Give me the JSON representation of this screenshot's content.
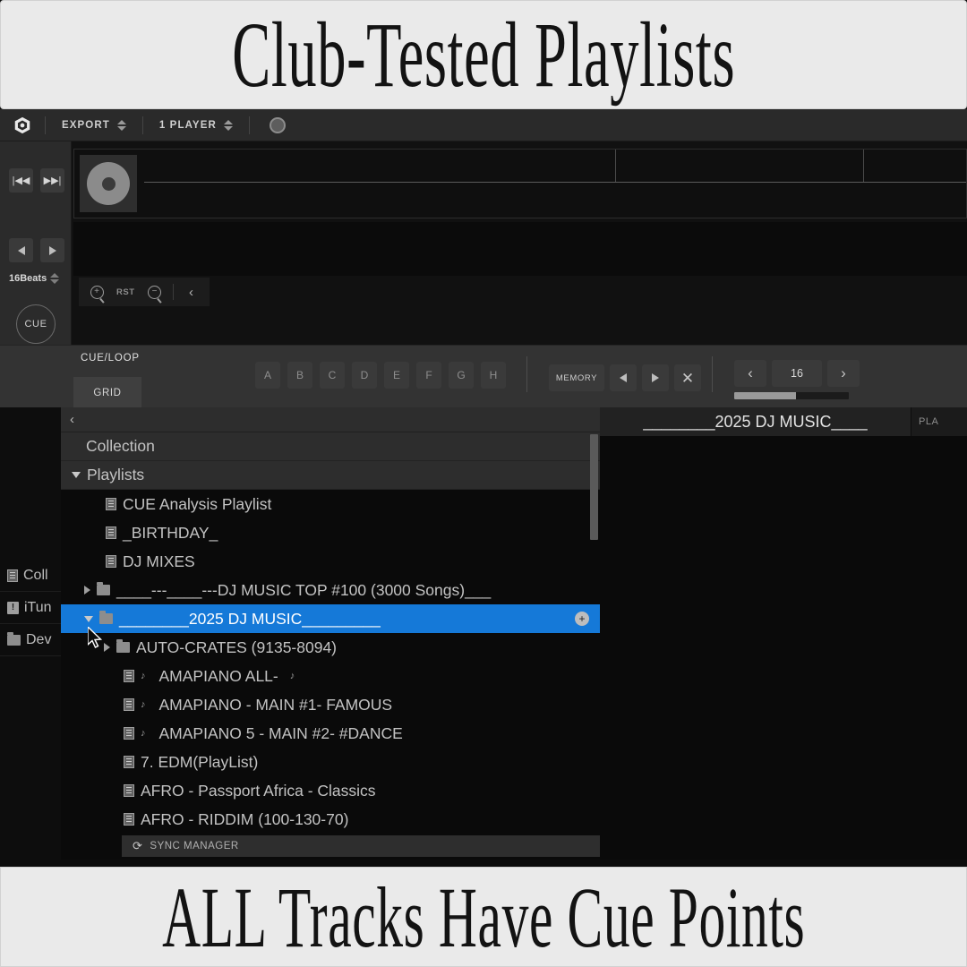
{
  "banners": {
    "top": "Club-Tested Playlists",
    "bottom": "ALL Tracks Have Cue Points"
  },
  "toolbar": {
    "logo_icon": "rekordbox-logo-icon",
    "export_label": "EXPORT",
    "player_label": "1 PLAYER",
    "record_icon": "record-icon"
  },
  "deck": {
    "prev_track_label": "|◀◀",
    "next_track_label": "▶▶|",
    "beats_label": "16Beats",
    "cue_label": "CUE",
    "play_icon": "play-icon",
    "zoom_in_icon": "zoom-in-icon",
    "zoom_reset_label": "RST",
    "zoom_out_icon": "zoom-out-icon",
    "collapse_icon": "chevron-left-icon",
    "disc_icon": "disc-icon"
  },
  "cueloop": {
    "title": "CUE/LOOP",
    "grid_tab": "GRID",
    "hotcues": [
      "A",
      "B",
      "C",
      "D",
      "E",
      "F",
      "G",
      "H"
    ],
    "memory_label": "MEMORY",
    "memory_prev_icon": "triangle-left-icon",
    "memory_next_icon": "triangle-right-icon",
    "memory_delete_icon": "close-x-icon",
    "beatjump_prev_icon": "chevron-left-icon",
    "beatjump_value": "16",
    "beatjump_next_icon": "chevron-right-icon",
    "beatjump_fill_pct": 54
  },
  "left_strip": {
    "items": [
      {
        "icon": "collection-list-icon",
        "label": "Coll"
      },
      {
        "icon": "itunes-warning-icon",
        "label": "iTun"
      },
      {
        "icon": "folder-icon",
        "label": "Dev"
      }
    ]
  },
  "tree": {
    "collapse_icon": "chevron-left-icon",
    "rows": [
      {
        "label": "Collection",
        "icon": "none",
        "caret": "none",
        "indent": 1,
        "style": "shaded",
        "selected": false
      },
      {
        "label": "Playlists",
        "icon": "none",
        "caret": "down",
        "indent": 0,
        "style": "shaded",
        "selected": false
      },
      {
        "label": "CUE Analysis Playlist",
        "icon": "list",
        "caret": "none",
        "indent": 2,
        "style": "plain",
        "selected": false
      },
      {
        "label": "_BIRTHDAY_",
        "icon": "list",
        "caret": "none",
        "indent": 2,
        "style": "plain",
        "selected": false
      },
      {
        "label": "DJ MIXES",
        "icon": "list",
        "caret": "none",
        "indent": 2,
        "style": "plain",
        "selected": false
      },
      {
        "label": "____---____---DJ MUSIC TOP #100 (3000 Songs)___",
        "icon": "folder",
        "caret": "right",
        "indent": 1,
        "style": "plain",
        "selected": false
      },
      {
        "label": "________2025 DJ MUSIC_________",
        "icon": "folder",
        "caret": "down",
        "indent": 1,
        "style": "plain",
        "selected": true,
        "badge": "+"
      },
      {
        "label": "AUTO-CRATES (9135-8094)",
        "icon": "folder",
        "caret": "right",
        "indent": 2,
        "style": "plain",
        "selected": false
      },
      {
        "label": "AMAPIANO ALL-",
        "icon": "list-note",
        "caret": "none",
        "indent": 3,
        "style": "plain",
        "selected": false
      },
      {
        "label": "AMAPIANO - MAIN #1- FAMOUS",
        "icon": "list-note",
        "caret": "none",
        "indent": 3,
        "style": "plain",
        "selected": false
      },
      {
        "label": "AMAPIANO 5 -  MAIN #2- #DANCE",
        "icon": "list-note",
        "caret": "none",
        "indent": 3,
        "style": "plain",
        "selected": false
      },
      {
        "label": "7. EDM(PlayList)",
        "icon": "list",
        "caret": "none",
        "indent": 3,
        "style": "plain",
        "selected": false
      },
      {
        "label": "AFRO - Passport Africa - Classics",
        "icon": "list",
        "caret": "none",
        "indent": 3,
        "style": "plain",
        "selected": false
      },
      {
        "label": "AFRO - RIDDIM (100-130-70)",
        "icon": "list",
        "caret": "none",
        "indent": 3,
        "style": "plain",
        "selected": false
      }
    ]
  },
  "sync": {
    "icon": "sync-icon",
    "label": "SYNC MANAGER"
  },
  "right_pane": {
    "tab_label": "________2025 DJ MUSIC____",
    "side_button_label": "PLA"
  },
  "colors": {
    "selection_blue": "#1579d8",
    "panel_dark": "#0a0a0a",
    "toolbar_gray": "#2a2a2a",
    "banner_bg": "#eaeaea"
  }
}
